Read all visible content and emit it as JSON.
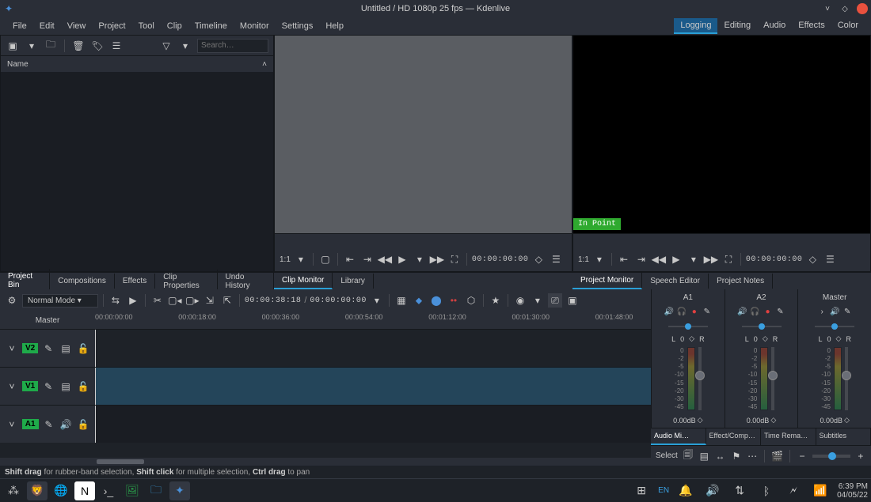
{
  "window": {
    "title": "Untitled / HD 1080p 25 fps — Kdenlive"
  },
  "menubar": {
    "items": [
      "File",
      "Edit",
      "View",
      "Project",
      "Tool",
      "Clip",
      "Timeline",
      "Monitor",
      "Settings",
      "Help"
    ],
    "right": [
      "Logging",
      "Editing",
      "Audio",
      "Effects",
      "Color"
    ],
    "right_active": 0
  },
  "bin": {
    "search_placeholder": "Search…",
    "header": "Name"
  },
  "tabs_left": [
    "Project Bin",
    "Compositions",
    "Effects",
    "Clip Properties",
    "Undo History"
  ],
  "tabs_left_active": 0,
  "tabs_mid": [
    "Clip Monitor",
    "Library"
  ],
  "tabs_mid_active": 0,
  "tabs_right": [
    "Project Monitor",
    "Speech Editor",
    "Project Notes"
  ],
  "tabs_right_active": 0,
  "monitors": {
    "clip": {
      "ratio": "1:1",
      "timecode": "00:00:00:00"
    },
    "project": {
      "ratio": "1:1",
      "timecode": "00:00:00:00",
      "in_point_label": "In Point"
    }
  },
  "timeline": {
    "mode": "Normal Mode",
    "position": "00:00:38:18",
    "duration": "00:00:00:00",
    "master_label": "Master",
    "ticks": [
      "00:00:00:00",
      "00:00:18:00",
      "00:00:36:00",
      "00:00:54:00",
      "00:01:12:00",
      "00:01:30:00",
      "00:01:48:00"
    ],
    "tracks": [
      {
        "label": "V2",
        "type": "video"
      },
      {
        "label": "V1",
        "type": "video"
      },
      {
        "label": "A1",
        "type": "audio"
      }
    ]
  },
  "mixer": {
    "channels": [
      {
        "name": "A1",
        "balance": "0",
        "db": "0.00dB"
      },
      {
        "name": "A2",
        "balance": "0",
        "db": "0.00dB"
      },
      {
        "name": "Master",
        "balance": "0",
        "db": "0.00dB"
      }
    ],
    "lr_labels": {
      "left": "L",
      "right": "R"
    },
    "scale": [
      "0",
      "-2",
      "-5",
      "-10",
      "-15",
      "-20",
      "-30",
      "-45"
    ],
    "tabs": [
      "Audio Mi…",
      "Effect/Composition …",
      "Time Rema…",
      "Subtitles"
    ],
    "tabs_active": 0
  },
  "select_row": {
    "label": "Select"
  },
  "status": {
    "parts": [
      "Shift drag",
      " for rubber-band selection, ",
      "Shift click",
      " for multiple selection, ",
      "Ctrl drag",
      " to pan"
    ]
  },
  "taskbar": {
    "lang": "EN",
    "time": "6:39 PM",
    "date": "04/05/22"
  }
}
